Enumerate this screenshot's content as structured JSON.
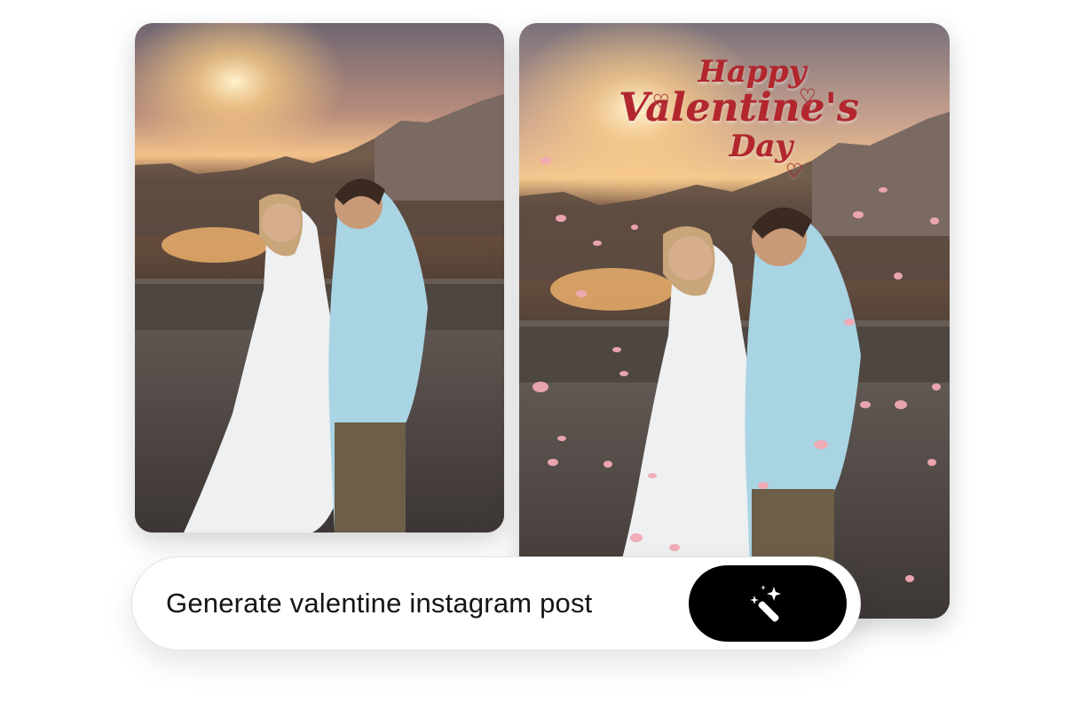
{
  "images": {
    "original": {
      "alt": "Couple embracing on a bridge at sunset"
    },
    "generated": {
      "alt": "Couple embracing on a bridge at sunset with falling rose petals",
      "overlay": {
        "line1": "Happy",
        "line2": "Valentine's",
        "line3": "Day"
      }
    }
  },
  "prompt": {
    "text": "Generate valentine instagram post",
    "button_icon": "magic-wand-sparkle-icon"
  },
  "colors": {
    "accent": "#b3262d",
    "button": "#000000",
    "petal": "#f2a9b4"
  }
}
